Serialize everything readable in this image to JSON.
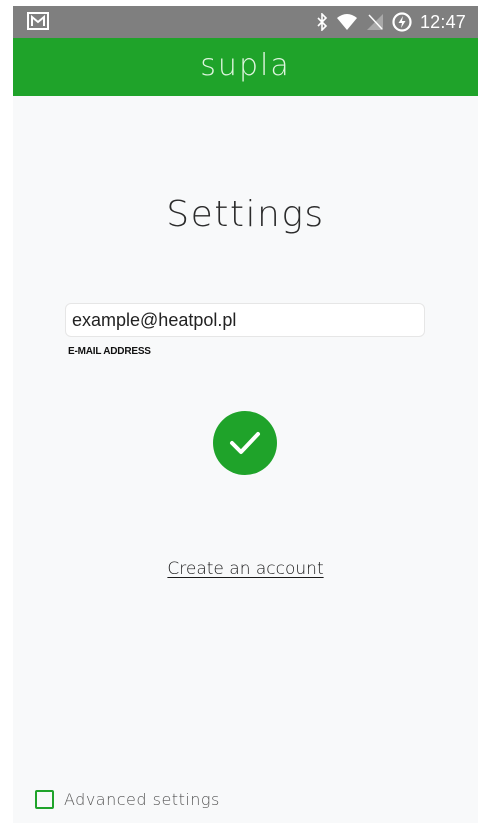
{
  "status_bar": {
    "time": "12:47",
    "icons": [
      "gmail-icon",
      "bluetooth-icon",
      "wifi-icon",
      "no-signal-icon",
      "battery-charging-icon"
    ]
  },
  "app_bar": {
    "title": "supla"
  },
  "main": {
    "title": "Settings",
    "email": {
      "value": "example@heatpol.pl",
      "label": "E-MAIL ADDRESS"
    },
    "confirm_icon": "check-icon",
    "create_account_link": "Create an account"
  },
  "footer": {
    "advanced_settings_label": "Advanced settings",
    "advanced_settings_checked": false
  },
  "colors": {
    "brand_green": "#1fa32a",
    "status_bar": "#7f7f7f",
    "background": "#f8f9fa"
  }
}
